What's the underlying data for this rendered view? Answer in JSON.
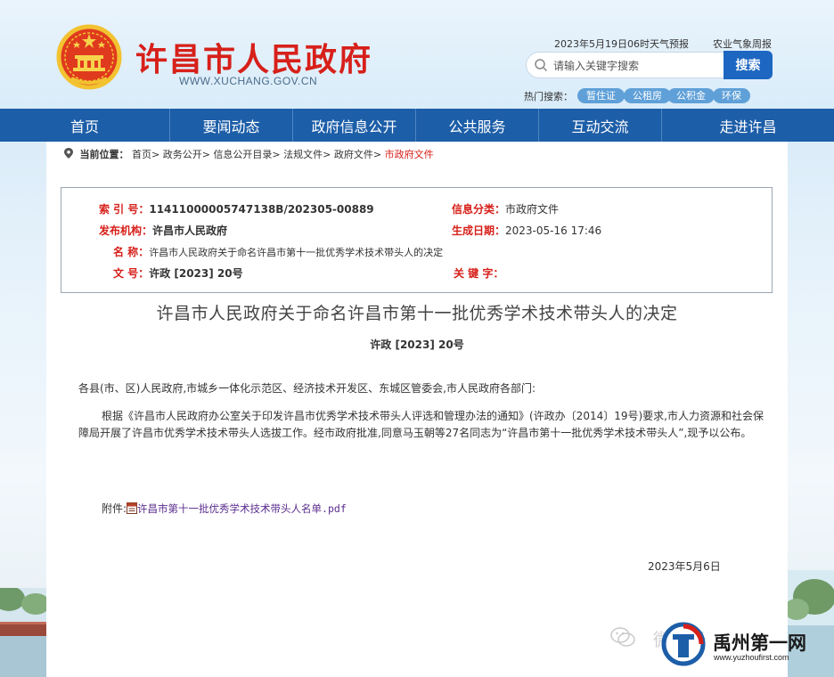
{
  "header": {
    "site_title": "许昌市人民政府",
    "site_url": "WWW.XUCHANG.GOV.CN",
    "weather_link": "2023年5月19日06时天气预报",
    "agri_link": "农业气象周报",
    "search": {
      "placeholder": "请输入关键字搜索",
      "button": "搜索"
    },
    "hot_search_label": "热门搜索：",
    "hot_tags": [
      "暂住证",
      "公租房",
      "公积金",
      "环保"
    ]
  },
  "nav": [
    "首页",
    "要闻动态",
    "政府信息公开",
    "公共服务",
    "互动交流",
    "走进许昌"
  ],
  "breadcrumb": {
    "label": "当前位置：",
    "items": [
      "首页>",
      "政务公开>",
      "信息公开目录>",
      "法规文件>",
      "政府文件>"
    ],
    "current": "市政府文件"
  },
  "info": {
    "index_label": "索 引 号：",
    "index_value": "11411000005747138B/202305-00889",
    "category_label": "信息分类：",
    "category_value": "市政府文件",
    "publisher_label": "发布机构：",
    "publisher_value": "许昌市人民政府",
    "date_label": "生成日期：",
    "date_value": "2023-05-16 17:46",
    "name_label": "名 称：",
    "name_value": "许昌市人民政府关于命名许昌市第十一批优秀学术技术带头人的决定",
    "docno_label": "文 号：",
    "docno_value": "许政 [2023] 20号",
    "keyword_label": "关 键 字：",
    "keyword_value": ""
  },
  "document": {
    "title": "许昌市人民政府关于命名许昌市第十一批优秀学术技术带头人的决定",
    "number": "许政 [2023] 20号",
    "salutation": "各县(市、区)人民政府,市城乡一体化示范区、经济技术开发区、东城区管委会,市人民政府各部门:",
    "body": "根据《许昌市人民政府办公室关于印发许昌市优秀学术技术带头人评选和管理办法的通知》(许政办〔2014〕19号)要求,市人力资源和社会保障局开展了许昌市优秀学术技术带头人选拔工作。经市政府批准,同意马玉朝等27名同志为“许昌市第十一批优秀学术技术带头人”,现予以公布。",
    "attachment_label": "附件:",
    "attachment_link": "许昌市第十一批优秀学术技术带头人名单.pdf",
    "date": "2023年5月6日"
  },
  "watermark": {
    "wechat_text": "微信号",
    "brand_name": "禹州第一网",
    "brand_url": "www.yuzhoufirst.com"
  },
  "colors": {
    "brand_red": "#d7201a",
    "nav_blue": "#1d5ea8",
    "search_blue": "#1d66c1"
  }
}
